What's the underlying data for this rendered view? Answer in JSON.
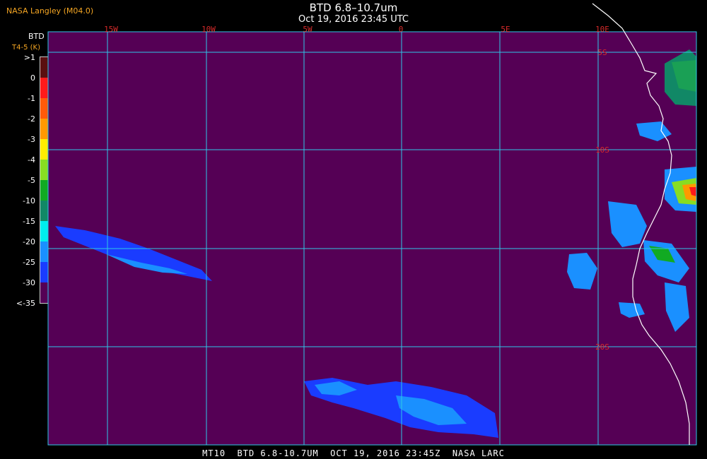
{
  "header": {
    "credit": "NASA Langley (M04.0)",
    "title": "BTD 6.8–10.7um",
    "subtitle": "Oct 19, 2016 23:45 UTC"
  },
  "footer": {
    "text": "MT10  BTD 6.8-10.7UM  OCT 19, 2016 23:45Z  NASA LARC"
  },
  "legend": {
    "title": "BTD",
    "units": "T4-5 (K)",
    "ticks": [
      ">1",
      "0",
      "-1",
      "-2",
      "-3",
      "-4",
      "-5",
      "-10",
      "-15",
      "-20",
      "-25",
      "-30",
      "<-35"
    ],
    "colors": [
      "#5a0f0f",
      "#ff1a1a",
      "#ff5a0a",
      "#ff9900",
      "#ffee00",
      "#88dd22",
      "#11aa22",
      "#118866",
      "#00eeee",
      "#1a90ff",
      "#1a3cff",
      "#550055"
    ]
  },
  "map": {
    "background": "#550055",
    "gridline_color": "#2ec7e6",
    "coastline_color": "#ffffff",
    "lon_labels": [
      "15W",
      "10W",
      "5W",
      "0",
      "5E",
      "10E"
    ],
    "lat_labels": [
      "5S",
      "10S",
      "20S"
    ],
    "label_color": "#d62a2a"
  }
}
